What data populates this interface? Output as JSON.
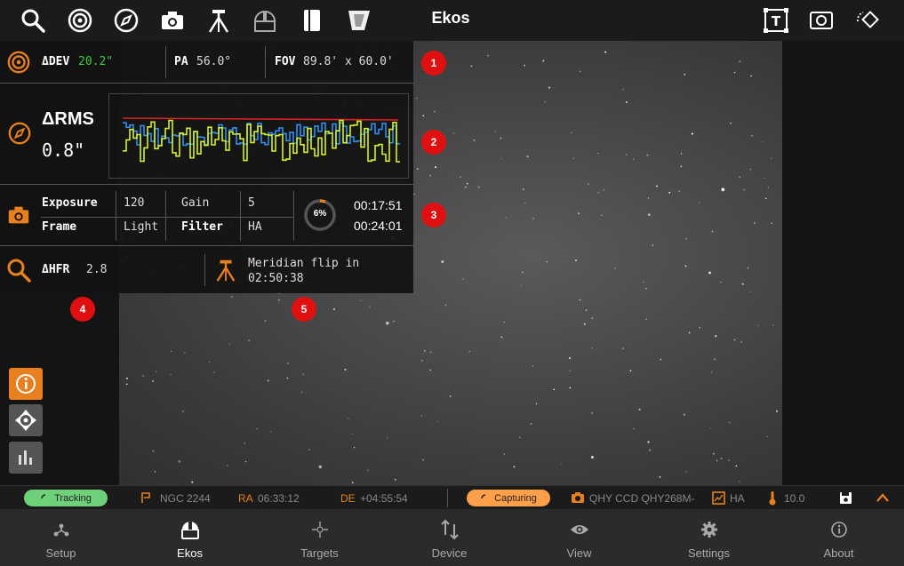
{
  "app": {
    "title": "Ekos"
  },
  "colors": {
    "accent": "#e88020",
    "green": "#3cd03c",
    "badge": "#e01010",
    "tracking_pill": "#6fd07a",
    "capturing_pill": "#ff9f4a"
  },
  "topbar": {
    "left_icons": [
      "search-icon",
      "target-icon",
      "compass-icon",
      "camera-icon",
      "tripod-icon",
      "observatory-icon",
      "notebook-icon",
      "flat-panel-icon"
    ],
    "right_icons": [
      "text-overlay-icon",
      "frame-icon",
      "rotate-icon"
    ]
  },
  "overlay": {
    "align": {
      "dev_label": "ΔDEV",
      "dev_value": "20.2\"",
      "pa_label": "PA",
      "pa_value": "56.0°",
      "fov_label": "FOV",
      "fov_value": "89.8' x 60.0'"
    },
    "guide": {
      "rms_label": "ΔRMS",
      "rms_value": "0.8\""
    },
    "capture": {
      "exposure_label": "Exposure",
      "exposure_value": "120",
      "gain_label": "Gain",
      "gain_value": "5",
      "frame_label": "Frame",
      "frame_value": "Light",
      "filter_label": "Filter",
      "filter_value": "HA",
      "progress_label": "6%",
      "progress": 0.06,
      "elapsed": "00:17:51",
      "total": "00:24:01"
    },
    "focus": {
      "hfr_label": "ΔHFR",
      "hfr_value": "2.8"
    },
    "mount": {
      "flip_line1": "Meridian flip in",
      "flip_line2": "02:50:38"
    },
    "badges": [
      "1",
      "2",
      "3",
      "4",
      "5"
    ]
  },
  "side_buttons": [
    "info-icon",
    "crosshair-move-icon",
    "histogram-icon"
  ],
  "statusbar": {
    "tracking": "Tracking",
    "target": "NGC 2244",
    "ra_label": "RA",
    "ra_value": "06:33:12",
    "de_label": "DE",
    "de_value": "+04:55:54",
    "capturing": "Capturing",
    "camera": "QHY CCD QHY268M-",
    "filter": "HA",
    "temperature": "10.0"
  },
  "nav": [
    {
      "label": "Setup",
      "icon": "setup-icon"
    },
    {
      "label": "Ekos",
      "icon": "ekos-icon"
    },
    {
      "label": "Targets",
      "icon": "targets-icon"
    },
    {
      "label": "Device",
      "icon": "device-icon"
    },
    {
      "label": "View",
      "icon": "view-icon"
    },
    {
      "label": "Settings",
      "icon": "settings-icon"
    },
    {
      "label": "About",
      "icon": "about-icon"
    }
  ]
}
